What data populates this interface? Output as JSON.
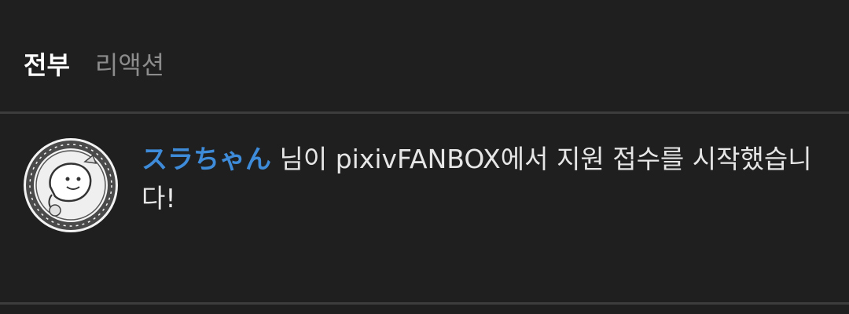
{
  "tabs": {
    "all_label": "전부",
    "reactions_label": "리액션"
  },
  "notification": {
    "username": "スラちゃん",
    "message_text": " 님이 pixivFANBOX에서 지원 접수를 시작했습니다!",
    "avatar_icon": "avatar-illustration-icon"
  },
  "colors": {
    "background": "#1f1f1f",
    "divider": "#3d3d3d",
    "username_link": "#3d8bd9",
    "active_tab": "#ffffff",
    "inactive_tab": "#8c8c8c"
  }
}
